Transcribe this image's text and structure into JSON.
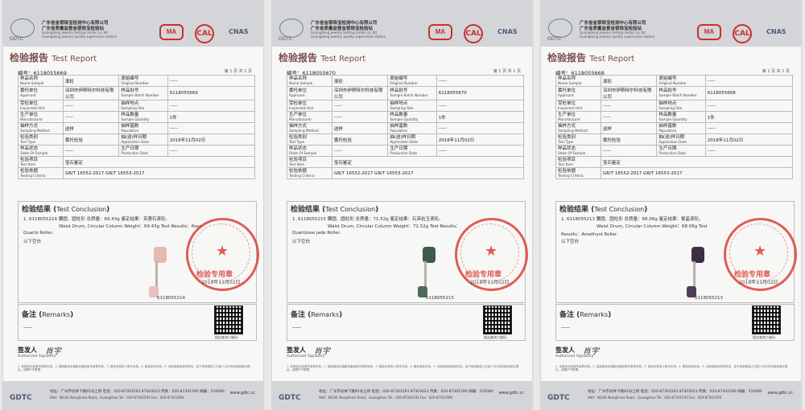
{
  "common": {
    "org_cn_1": "广东省金银珠宝检测中心有限公司",
    "org_cn_2": "广东省质量监督金银珠宝检验站",
    "org_en_1": "Guangdong jewelry testing center co.,ltd",
    "org_en_2": "Guangdong jewelry quality supervision station",
    "logo_text": "GDTC",
    "cert_ma": "MA",
    "cert_ca": "CAL",
    "cert_cnas": "CNAS",
    "report_title_cn": "检验报告",
    "report_title_en": "Test Report",
    "report_no_label": "编号：",
    "page_text": "第 1 页 共 1 页",
    "labels": {
      "sample_name": {
        "cn": "样品名称",
        "en": "Name Sample"
      },
      "original_no": {
        "cn": "原始编号",
        "en": "Original Number"
      },
      "applicant": {
        "cn": "委托单位",
        "en": "Applicant"
      },
      "batch_no": {
        "cn": "样品批号",
        "en": "Sample Batch Number"
      },
      "inspected_unit": {
        "cn": "受检单位",
        "en": "Inspected Unit"
      },
      "sampling_site": {
        "cn": "抽样地点",
        "en": "Sampling Site"
      },
      "manufacturer": {
        "cn": "生产单位",
        "en": "Manufacturer"
      },
      "quantity": {
        "cn": "样品数量",
        "en": "Sample Quantity"
      },
      "sampling_method": {
        "cn": "抽样方式",
        "en": "Sampling Method"
      },
      "population": {
        "cn": "抽样基数",
        "en": "Population"
      },
      "test_type": {
        "cn": "检验类别",
        "en": "Test Type"
      },
      "application_date": {
        "cn": "抽(送)样日期",
        "en": "Application Date"
      },
      "state_of_sample": {
        "cn": "样品状态",
        "en": "State Of Sample"
      },
      "production_date": {
        "cn": "生产日期",
        "en": "Production Date"
      },
      "test_item": {
        "cn": "检验项目",
        "en": "Test Item"
      },
      "testing_criteria": {
        "cn": "检验依据",
        "en": "Testing Criteria"
      }
    },
    "values": {
      "sample_name": "滚轮",
      "dash": "-----",
      "applicant": "深圳市伊斯特尔科技有限公司",
      "quantity": "1件",
      "sampling_method": "送样",
      "test_type": "委托检验",
      "application_date": "2018年11月02日",
      "test_item": "宝石鉴定",
      "criteria": "GB/T 16552-2017  GB/T 16553-2017"
    },
    "conclusion_cn": "检验结果",
    "conclusion_en": "Test Conclusion",
    "remarks_cn": "备注",
    "remarks_en": "Remarks",
    "qr_caption": "报告查询二维码",
    "signer_cn": "签发人",
    "signer_en": "Authorized Signatory",
    "signature": "肖宇",
    "stamp_text": "检验专用章",
    "footnote": "1. 本报告无检验专用章无效。2. 复制报告未重新加盖检验专用章无效。3. 报告无签发人签字无效。4. 报告涂改无效。5. 对检验报告若有异议，应于收到报告之日起十五日内向检验单位提出，逾期不予受理。",
    "addr_cn": "地址：广州市农林下路81号之四  电话：020-87301593  87303023  传真：020-87301590  邮编：510080",
    "addr_en": "Add：NO.81 Nonglinxia Road，Guangzhou  Tel：020-87301593  Fax：020-87301590",
    "web": "www.gdtc.cc"
  },
  "reports": [
    {
      "report_no": "6118055669",
      "batch_no": "6118055669",
      "line1": "1. 6118055214   腰圆、圆柱形    总质量：69.43g   鉴定结果：芙蓉石滚轮。",
      "line2": "Waist Drum, Circular Column   Weight：69.43g   Test Results：Rose",
      "line3": "Quartz Roller.",
      "line4": "以下空白",
      "product_code": "6118055214",
      "stamp_date": "2018年11月02日",
      "head_color": "#e6b8b2",
      "tail_color": "#e7c2bd"
    },
    {
      "report_no": "6118055670",
      "batch_no": "6118055670",
      "line1": "1. 6118055215   腰圆、圆柱形    总质量：71.52g   鉴定结果：石英岩玉滚轮。",
      "line2": "Waist Drum, Circular Column   Weight：71.52g   Test Results：",
      "line3": "Quartzose jade Roller.",
      "line4": "以下空白",
      "product_code": "6118055215",
      "stamp_date": "2018年11月02日",
      "head_color": "#3e5a4c",
      "tail_color": "#4f6a5b"
    },
    {
      "report_no": "6118055668",
      "batch_no": "6118055668",
      "line1": "1. 6118055213   腰圆、圆柱形    总质量：68.06g   鉴定结果：紫晶滚轮。",
      "line2": "Waist Drum, Circular Column   Weight：68.06g   Test",
      "line3": "Results：Amethyst Roller.",
      "line4": "以下空白",
      "product_code": "6118055213",
      "stamp_date": "2018年11月02日",
      "head_color": "#3b2f45",
      "tail_color": "#4d3e58"
    }
  ]
}
